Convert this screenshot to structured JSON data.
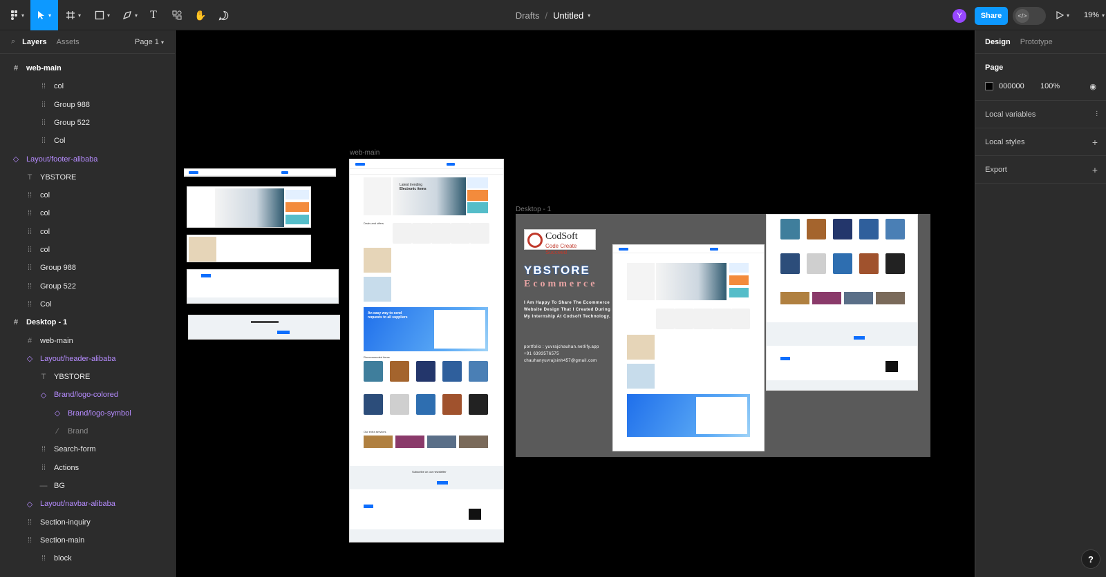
{
  "toolbar": {
    "breadcrumb_project": "Drafts",
    "breadcrumb_sep": "/",
    "file_name": "Untitled",
    "avatar_letter": "Y",
    "share_label": "Share",
    "zoom": "19%"
  },
  "left_panel": {
    "tabs": [
      "Layers",
      "Assets"
    ],
    "page_selector": "Page 1",
    "layers": [
      {
        "label": "web-main",
        "type": "frame",
        "indent": 0
      },
      {
        "label": "col",
        "type": "group",
        "indent": 2
      },
      {
        "label": "Group 988",
        "type": "group",
        "indent": 2
      },
      {
        "label": "Group 522",
        "type": "group",
        "indent": 2
      },
      {
        "label": "Col",
        "type": "group",
        "indent": 2
      },
      {
        "label": "Layout/footer-alibaba",
        "type": "component",
        "indent": 0
      },
      {
        "label": "YBSTORE",
        "type": "text",
        "indent": 1
      },
      {
        "label": "col",
        "type": "group",
        "indent": 1
      },
      {
        "label": "col",
        "type": "group",
        "indent": 1
      },
      {
        "label": "col",
        "type": "group",
        "indent": 1
      },
      {
        "label": "col",
        "type": "group",
        "indent": 1
      },
      {
        "label": "Group 988",
        "type": "group",
        "indent": 1
      },
      {
        "label": "Group 522",
        "type": "group",
        "indent": 1
      },
      {
        "label": "Col",
        "type": "group",
        "indent": 1
      },
      {
        "label": "Desktop - 1",
        "type": "frame",
        "indent": 0
      },
      {
        "label": "web-main",
        "type": "frame-child",
        "indent": 1
      },
      {
        "label": "Layout/header-alibaba",
        "type": "component",
        "indent": 1
      },
      {
        "label": "YBSTORE",
        "type": "text",
        "indent": 2
      },
      {
        "label": "Brand/logo-colored",
        "type": "component",
        "indent": 2
      },
      {
        "label": "Brand/logo-symbol",
        "type": "component",
        "indent": 3
      },
      {
        "label": "Brand",
        "type": "vector",
        "indent": 3
      },
      {
        "label": "Search-form",
        "type": "group",
        "indent": 2
      },
      {
        "label": "Actions",
        "type": "group",
        "indent": 2
      },
      {
        "label": "BG",
        "type": "line",
        "indent": 2
      },
      {
        "label": "Layout/navbar-alibaba",
        "type": "component",
        "indent": 1
      },
      {
        "label": "Section-inquiry",
        "type": "group",
        "indent": 1
      },
      {
        "label": "Section-main",
        "type": "group",
        "indent": 1
      },
      {
        "label": "block",
        "type": "group",
        "indent": 2
      }
    ]
  },
  "right_panel": {
    "tabs": [
      "Design",
      "Prototype"
    ],
    "page_title": "Page",
    "page_color": "000000",
    "page_opacity": "100%",
    "local_variables": "Local variables",
    "local_styles": "Local styles",
    "export": "Export"
  },
  "canvas": {
    "frame_labels": [
      "web-main",
      "Desktop - 1"
    ],
    "codsoft_name": "CodSoft",
    "codsoft_tagline": "Code Create Succeed",
    "store_title": "YBSTORE",
    "store_subtitle": "Ecommerce",
    "intro_text": "I Am Happy To Share The Ecommerce Website Design That I Created During My Internship At Codsoft Technology.",
    "portfolio": "portfolio : yuvrajchauhan.netlify.app",
    "phone": "+91 6393576575",
    "email": "chauhanyuvrajsinh457@gmail.com",
    "mock_hero_line1": "Latest trending",
    "mock_hero_line2": "Electronic items",
    "mock_inquiry_line1": "An easy way to send",
    "mock_inquiry_line2": "requests to all suppliers",
    "mock_section_recommended": "Recommended items",
    "mock_section_services": "Our extra services",
    "mock_newsletter": "Subscribe on our newsletter",
    "mock_deals": "Deals and offers"
  },
  "colors": {
    "accent": "#0d99ff",
    "component": "#b68cff",
    "panel": "#2c2c2c"
  }
}
